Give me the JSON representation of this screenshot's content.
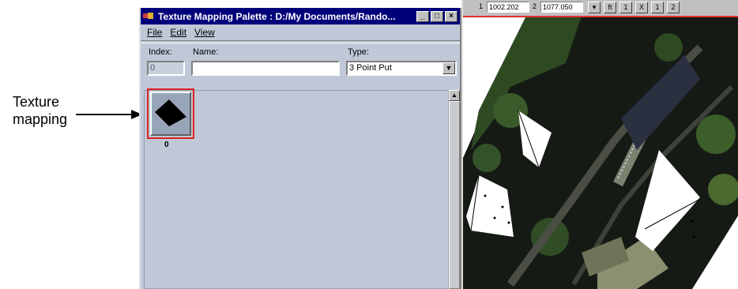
{
  "annotation": {
    "label_line1": "Texture",
    "label_line2": "mapping"
  },
  "window": {
    "title": "Texture Mapping Palette : D:/My Documents/Rando...",
    "buttons": {
      "minimize": "_",
      "maximize": "□",
      "close": "×"
    }
  },
  "menu": {
    "file": "File",
    "edit": "Edit",
    "view": "View"
  },
  "form": {
    "index_label": "Index:",
    "index_value": "0",
    "name_label": "Name:",
    "name_value": "",
    "type_label": "Type:",
    "type_value": "3 Point Put"
  },
  "palette": {
    "items": [
      {
        "index": "0"
      }
    ]
  },
  "map_toolbar": {
    "x_label": "1",
    "x_value": "1002.202",
    "y_label": "2",
    "y_value": "1077.050",
    "button_labels": [
      "▾",
      "ft",
      "1",
      "X",
      "1",
      "2"
    ]
  },
  "colors": {
    "titlebar": "#00007b",
    "window_bg": "#c0c8d8",
    "highlight": "#e02020"
  }
}
